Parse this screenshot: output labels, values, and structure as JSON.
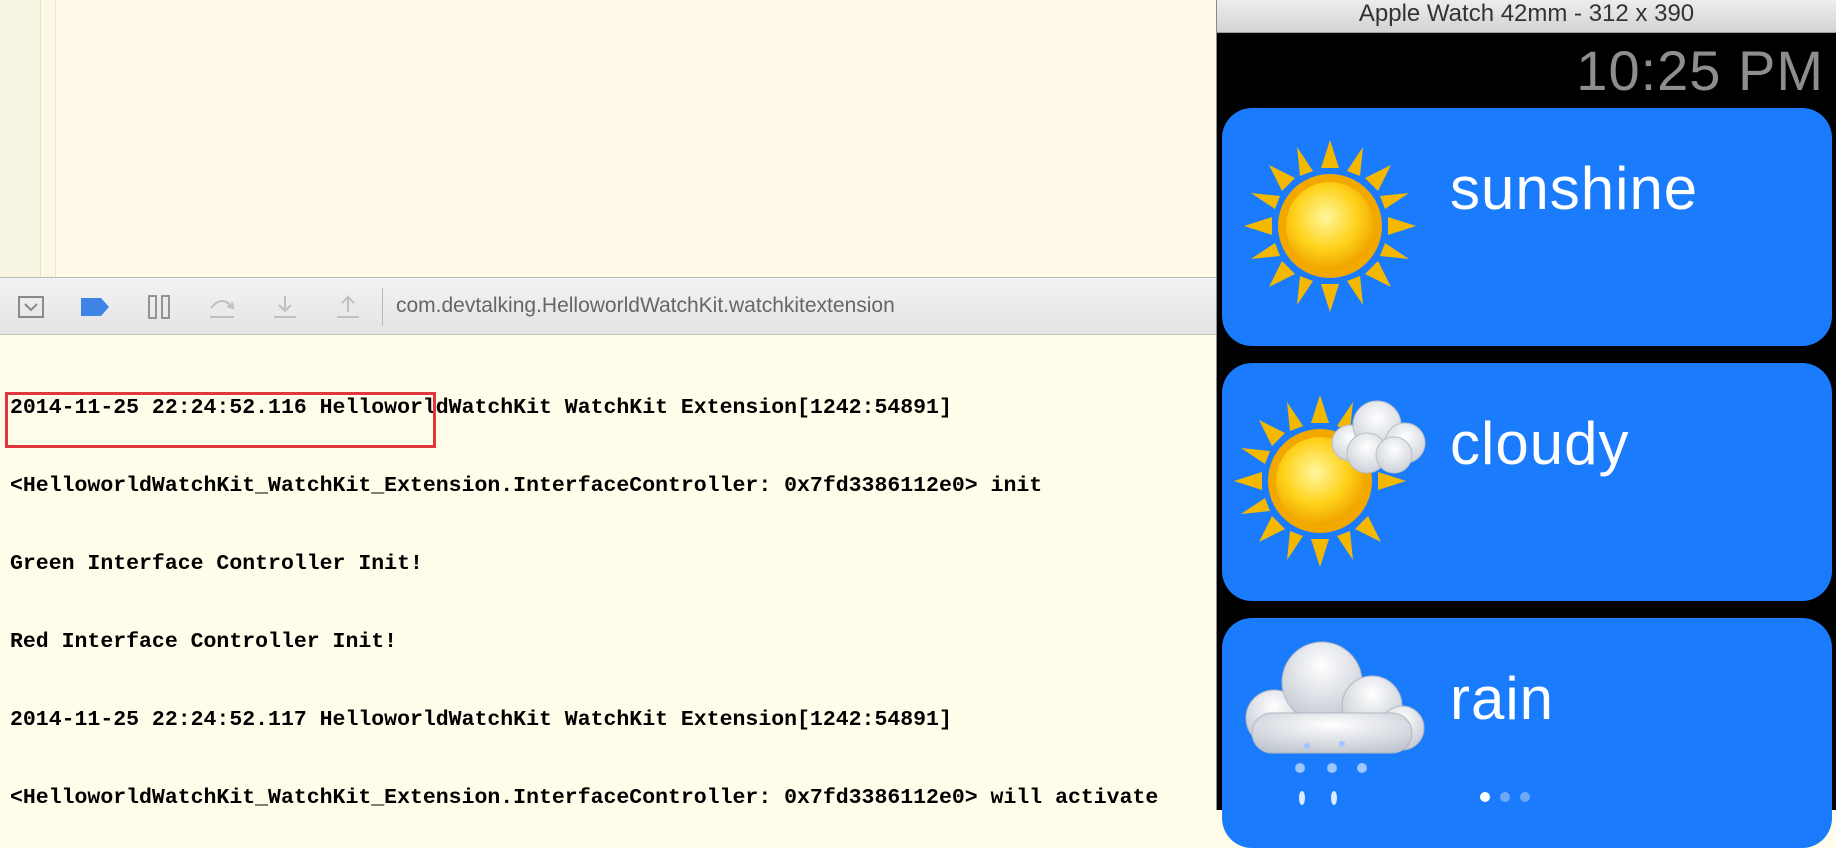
{
  "debug_bar": {
    "process_name": "com.devtalking.HelloworldWatchKit.watchkitextension",
    "buttons": [
      "hide-debug-area-icon",
      "breakpoints-icon",
      "pause-icon",
      "step-over-icon",
      "step-into-icon",
      "step-out-icon"
    ]
  },
  "console": {
    "lines": [
      "2014-11-25 22:24:52.116 HelloworldWatchKit WatchKit Extension[1242:54891]",
      "<HelloworldWatchKit_WatchKit_Extension.InterfaceController: 0x7fd3386112e0> init",
      "Green Interface Controller Init!",
      "Red Interface Controller Init!",
      "2014-11-25 22:24:52.117 HelloworldWatchKit WatchKit Extension[1242:54891]",
      "<HelloworldWatchKit_WatchKit_Extension.InterfaceController: 0x7fd3386112e0> will activate"
    ]
  },
  "watch": {
    "title": "Apple Watch 42mm - 312 x 390",
    "time": "10:25 PM",
    "rows": [
      {
        "label": "sunshine",
        "icon": "sun-icon"
      },
      {
        "label": "cloudy",
        "icon": "sun-cloud-icon"
      },
      {
        "label": "rain",
        "icon": "rain-cloud-icon"
      }
    ],
    "page_count": 3,
    "page_active": 1
  },
  "colors": {
    "row_blue": "#1a7cfc",
    "console_bg": "#fffdea",
    "highlight_red": "#e0383e"
  }
}
